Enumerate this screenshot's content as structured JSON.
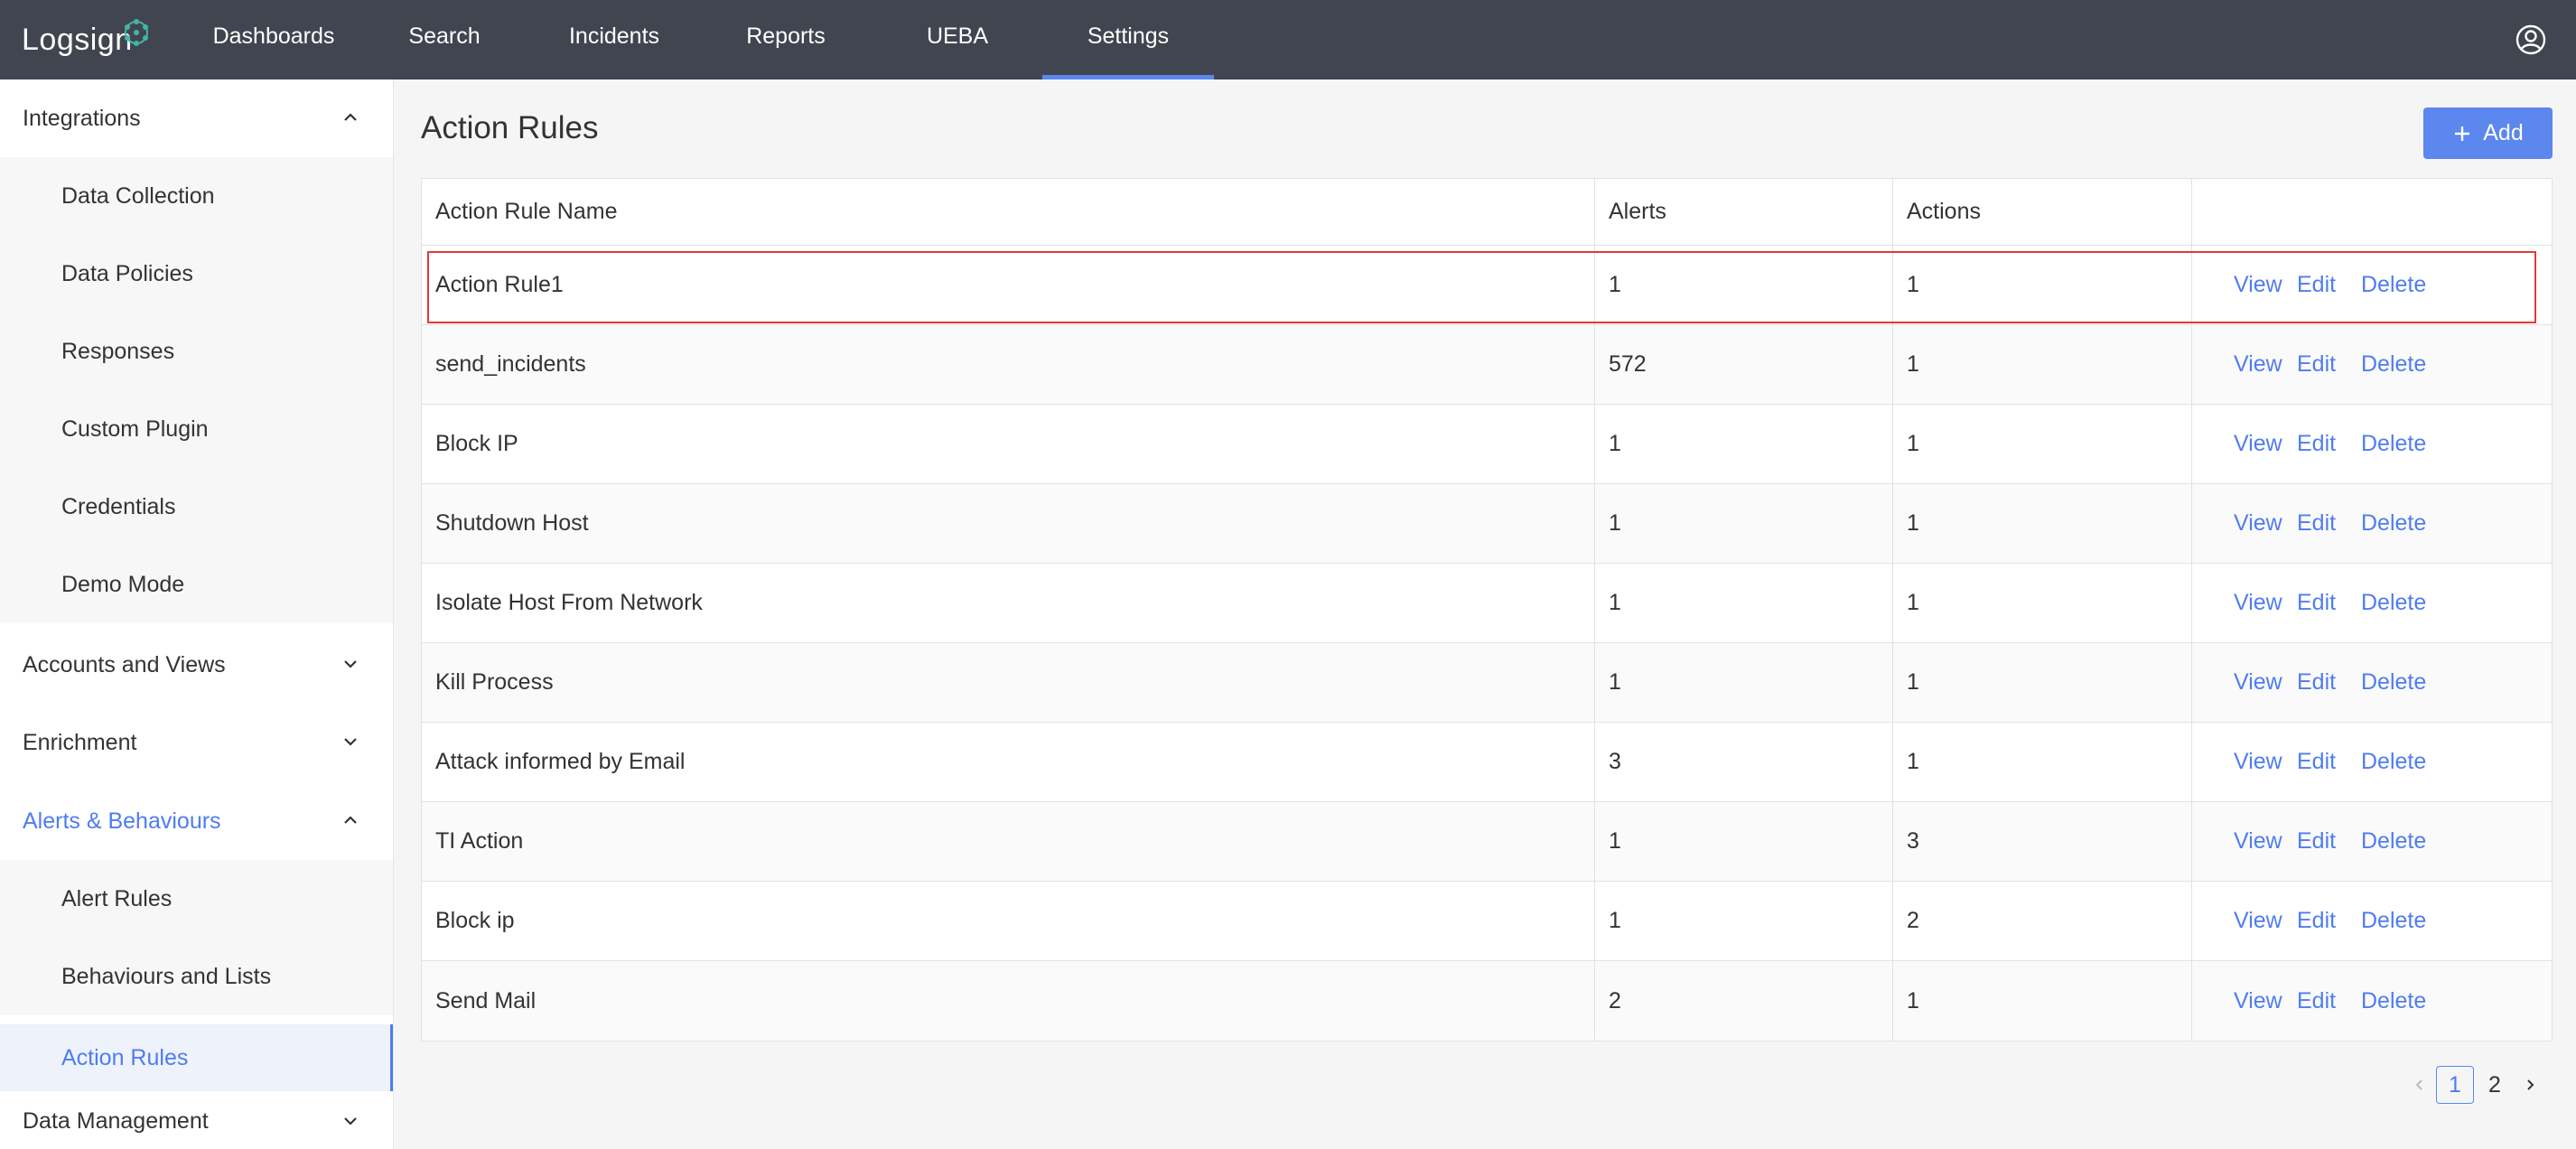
{
  "nav": {
    "logo": "Logsign",
    "items": [
      {
        "label": "Dashboards"
      },
      {
        "label": "Search"
      },
      {
        "label": "Incidents"
      },
      {
        "label": "Reports"
      },
      {
        "label": "UEBA"
      },
      {
        "label": "Settings",
        "active": true
      }
    ],
    "user_icon": "user-circle-icon"
  },
  "sidebar": {
    "groups": [
      {
        "label": "Integrations",
        "expanded": true,
        "items": [
          "Data Collection",
          "Data Policies",
          "Responses",
          "Custom Plugin",
          "Credentials",
          "Demo Mode"
        ]
      },
      {
        "label": "Accounts and Views",
        "expanded": false
      },
      {
        "label": "Enrichment",
        "expanded": false
      },
      {
        "label": "Alerts & Behaviours",
        "expanded": true,
        "items": [
          "Alert Rules",
          "Behaviours and Lists",
          "Action Rules"
        ],
        "active_item": "Action Rules"
      },
      {
        "label": "Data Management",
        "expanded": false
      }
    ]
  },
  "main": {
    "title": "Action Rules",
    "add_label": "Add",
    "table": {
      "headers": [
        "Action Rule Name",
        "Alerts",
        "Actions",
        ""
      ],
      "rows": [
        {
          "name": "Action Rule1",
          "alerts": "1",
          "actions": "1"
        },
        {
          "name": "send_incidents",
          "alerts": "572",
          "actions": "1"
        },
        {
          "name": "Block IP",
          "alerts": "1",
          "actions": "1"
        },
        {
          "name": "Shutdown Host",
          "alerts": "1",
          "actions": "1"
        },
        {
          "name": "Isolate Host From Network",
          "alerts": "1",
          "actions": "1"
        },
        {
          "name": "Kill Process",
          "alerts": "1",
          "actions": "1"
        },
        {
          "name": "Attack informed by Email",
          "alerts": "3",
          "actions": "1"
        },
        {
          "name": "TI Action",
          "alerts": "1",
          "actions": "3"
        },
        {
          "name": "Block ip",
          "alerts": "1",
          "actions": "2"
        },
        {
          "name": "Send Mail",
          "alerts": "2",
          "actions": "1"
        }
      ],
      "row_actions": [
        "View",
        "Edit",
        "Delete"
      ]
    },
    "pagination": {
      "pages": [
        "1",
        "2"
      ],
      "current": "1"
    }
  },
  "colors": {
    "nav_bg": "#41454f",
    "accent": "#5b87ee",
    "link": "#4f7cf0",
    "highlight": "#e53935"
  }
}
